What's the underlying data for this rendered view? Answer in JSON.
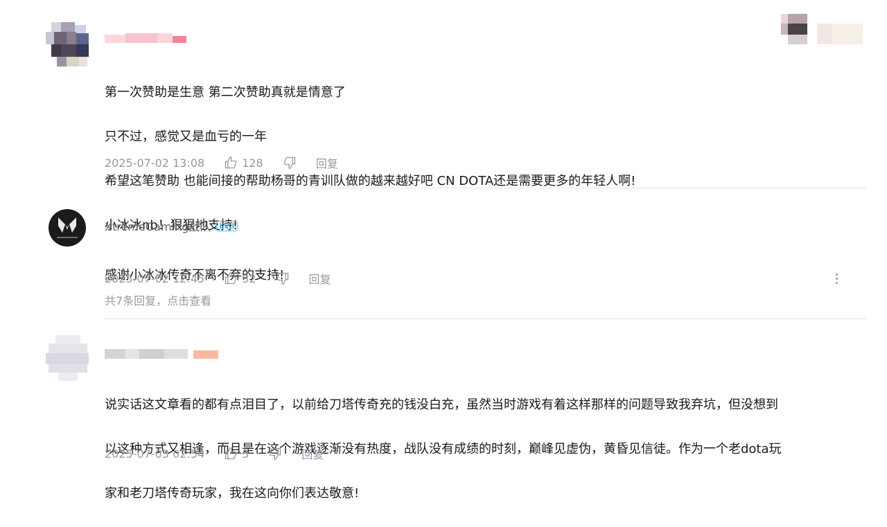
{
  "colors": {
    "text_primary": "#18191c",
    "text_meta": "#9499a0",
    "divider": "#e3e5e7",
    "level_badge": "#4fc3f7"
  },
  "comments": [
    {
      "username": "",
      "avatar_icon": "blurred-avatar",
      "lines": [
        "第一次赞助是生意 第二次赞助真就是情意了",
        "只不过，感觉又是血亏的一年",
        "希望这笔赞助 也能间接的帮助杨哥的青训队做的越来越好吧 CN DOTA还是需要更多的年轻人啊!",
        "小冰冰nb！狠狠地支持!"
      ],
      "time": "2025-07-02 13:08",
      "likes": "128",
      "reply_label": "回复"
    },
    {
      "username": "XtremeGaming战队",
      "level_badge": "LV3",
      "avatar_icon": "xg-logo-avatar",
      "lines": [
        "感谢小冰冰传奇不离不弃的支持!"
      ],
      "time": "2025-07-02 12:45",
      "likes": "52",
      "reply_label": "回复",
      "replies_link": "共7条回复，点击查看"
    },
    {
      "username": "",
      "avatar_icon": "blurred-avatar",
      "lines": [
        "说实话这文章看的都有点泪目了，以前给刀塔传奇充的钱没白充，虽然当时游戏有着这样那样的问题导致我弃坑，但没想到",
        "以这种方式又相逢，而且是在这个游戏逐渐没有热度，战队没有成绩的时刻，巅峰见虚伪，黄昏见信徒。作为一个老dota玩",
        "家和老刀塔传奇玩家，我在这向你们表达敬意!"
      ],
      "time": "2025-07-03 02:54",
      "likes": "3",
      "reply_label": "回复"
    }
  ]
}
